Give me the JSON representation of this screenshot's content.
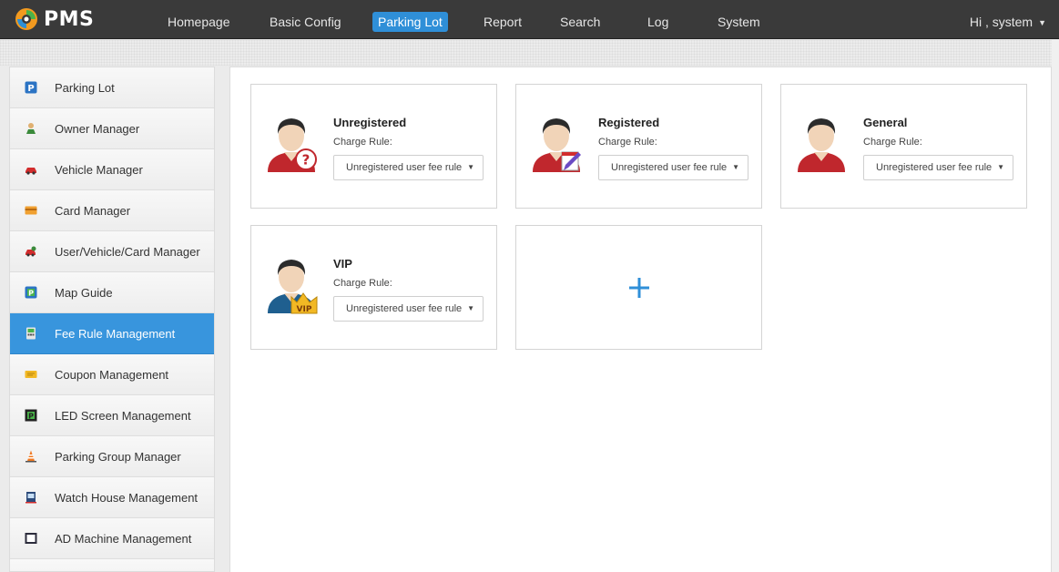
{
  "app": {
    "name": "PMS"
  },
  "nav": {
    "items": [
      {
        "label": "Homepage",
        "active": false
      },
      {
        "label": "Basic Config",
        "active": false
      },
      {
        "label": "Parking Lot",
        "active": true
      },
      {
        "label": "Report",
        "active": false
      },
      {
        "label": "Search",
        "active": false
      },
      {
        "label": "Log",
        "active": false
      },
      {
        "label": "System",
        "active": false
      }
    ],
    "user_greeting": "Hi , system"
  },
  "sidebar": {
    "items": [
      {
        "label": "Parking Lot",
        "icon": "parking-lot-icon",
        "active": false
      },
      {
        "label": "Owner Manager",
        "icon": "owner-icon",
        "active": false
      },
      {
        "label": "Vehicle Manager",
        "icon": "vehicle-icon",
        "active": false
      },
      {
        "label": "Card Manager",
        "icon": "card-icon",
        "active": false
      },
      {
        "label": "User/Vehicle/Card Manager",
        "icon": "user-vehicle-card-icon",
        "active": false
      },
      {
        "label": "Map Guide",
        "icon": "map-guide-icon",
        "active": false
      },
      {
        "label": "Fee Rule Management",
        "icon": "fee-rule-icon",
        "active": true
      },
      {
        "label": "Coupon Management",
        "icon": "coupon-icon",
        "active": false
      },
      {
        "label": "LED Screen Management",
        "icon": "led-screen-icon",
        "active": false
      },
      {
        "label": "Parking Group Manager",
        "icon": "parking-group-icon",
        "active": false
      },
      {
        "label": "Watch House Management",
        "icon": "watch-house-icon",
        "active": false
      },
      {
        "label": "AD Machine Management",
        "icon": "ad-machine-icon",
        "active": false
      }
    ]
  },
  "main": {
    "cards": [
      {
        "title": "Unregistered",
        "rule_label": "Charge Rule:",
        "rule_value": "Unregistered user fee rule",
        "badge": "question"
      },
      {
        "title": "Registered",
        "rule_label": "Charge Rule:",
        "rule_value": "Unregistered user fee rule",
        "badge": "pencil"
      },
      {
        "title": "General",
        "rule_label": "Charge Rule:",
        "rule_value": "Unregistered user fee rule",
        "badge": "none"
      },
      {
        "title": "VIP",
        "rule_label": "Charge Rule:",
        "rule_value": "Unregistered user fee rule",
        "badge": "crown",
        "badge_text": "VIP"
      }
    ],
    "add_card_icon": "plus-icon"
  },
  "colors": {
    "topbar": "#3a3a3a",
    "accent": "#2f8fd8",
    "sidebar_active": "#3895dd",
    "plus": "#2f8fd8",
    "avatar_shirt_red": "#c0272d",
    "avatar_shirt_blue": "#1f5f8f"
  }
}
